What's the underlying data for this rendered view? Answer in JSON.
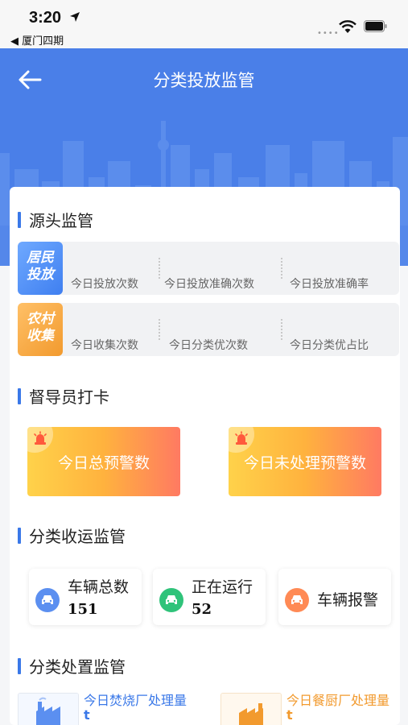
{
  "status_bar": {
    "time": "3:20",
    "back_app": "◀ 厦门四期",
    "signal_dots": "••••"
  },
  "header": {
    "title": "分类投放监管"
  },
  "source_section": {
    "title": "源头监管",
    "resident": {
      "badge": [
        "居民",
        "投放"
      ],
      "stats": [
        "今日投放次数",
        "今日投放准确次数",
        "今日投放准确率"
      ]
    },
    "rural": {
      "badge": [
        "农村",
        "收集"
      ],
      "stats": [
        "今日收集次数",
        "今日分类优次数",
        "今日分类优占比"
      ]
    }
  },
  "supervisor_section": {
    "title": "督导员打卡",
    "cards": [
      "今日总预警数",
      "今日未处理预警数"
    ]
  },
  "transport_section": {
    "title": "分类收运监管",
    "vehicles": [
      {
        "label": "车辆总数",
        "value": "151",
        "color": "#5b8ff0"
      },
      {
        "label": "正在运行",
        "value": "52",
        "color": "#2fc37a"
      },
      {
        "label": "车辆报警",
        "value": "",
        "color": "#ff8a55"
      }
    ]
  },
  "disposal_section": {
    "title": "分类处置监管",
    "items": [
      {
        "label": "今日焚烧厂处理量",
        "unit": "t",
        "color": "#3a78e8"
      },
      {
        "label": "今日餐厨厂处理量",
        "unit": "t",
        "color": "#f29a2e"
      }
    ]
  },
  "colors": {
    "primary": "#4a7fe8",
    "accent_blue": "#3a78e8",
    "warning_gradient_start": "#ffd24a",
    "warning_gradient_end": "#ff7a62"
  }
}
